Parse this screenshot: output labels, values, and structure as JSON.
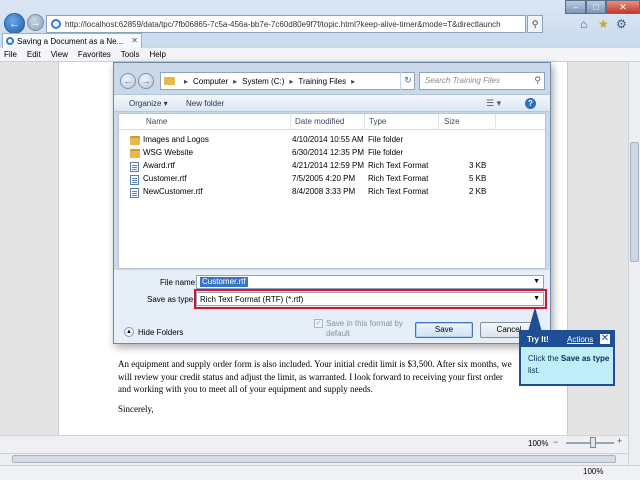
{
  "browser": {
    "address": "http://localhost:62859/data/tpc/7fb06865-7c5a-456a-bb7e-7c60d80e9f7f/topic.html?keep-alive-timer&mode=T&directlaunch",
    "tab_title": "Saving a Document as a Ne...",
    "menu": [
      "File",
      "Edit",
      "View",
      "Favorites",
      "Tools",
      "Help"
    ],
    "zoom": "100%"
  },
  "dialog": {
    "breadcrumb": [
      "Computer",
      "System (C:)",
      "Training Files"
    ],
    "search_placeholder": "Search Training Files",
    "toolbar": {
      "organize": "Organize ▾",
      "new_folder": "New folder"
    },
    "columns": [
      "Name",
      "Date modified",
      "Type",
      "Size"
    ],
    "files": [
      {
        "name": "Images and Logos",
        "date": "4/10/2014 10:55 AM",
        "type": "File folder",
        "size": "",
        "icon": "folder-icon"
      },
      {
        "name": "WSG Website",
        "date": "6/30/2014 12:35 PM",
        "type": "File folder",
        "size": "",
        "icon": "folder-icon"
      },
      {
        "name": "Award.rtf",
        "date": "4/21/2014 12:59 PM",
        "type": "Rich Text Format",
        "size": "3 KB",
        "icon": "rtf-file-icon"
      },
      {
        "name": "Customer.rtf",
        "date": "7/5/2005 4:20 PM",
        "type": "Rich Text Format",
        "size": "5 KB",
        "icon": "rtf-file-icon"
      },
      {
        "name": "NewCustomer.rtf",
        "date": "8/4/2008 3:33 PM",
        "type": "Rich Text Format",
        "size": "2 KB",
        "icon": "rtf-file-icon"
      }
    ],
    "file_name_label": "File name:",
    "file_name_value": "Customer.rtf",
    "save_type_label": "Save as type:",
    "save_type_value": "Rich Text Format (RTF) (*.rtf)",
    "hide_folders": "Hide Folders",
    "default_checkbox": "Save in this format by default",
    "save": "Save",
    "cancel": "Cancel",
    "highlight_color": "#d2152b"
  },
  "document": {
    "paragraph": "An equipment and supply order form is also included. Your initial credit limit is $3,500. After six months, we will review your credit status and adjust the limit, as warranted. I look forward to receiving your first order and working with you to meet all of your equipment and supply needs.",
    "closing": "Sincerely,",
    "zoom": "100%"
  },
  "callout": {
    "title": "Try It!",
    "actions": "Actions",
    "text_before": "Click the ",
    "text_bold": "Save as type",
    "text_after": " list.",
    "bg_color": "#bfeef9",
    "border_color": "#1e4e93"
  }
}
